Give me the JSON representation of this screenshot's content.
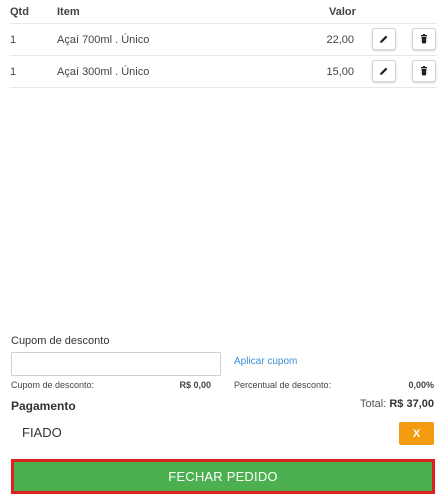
{
  "table": {
    "headers": {
      "qty": "Qtd",
      "item": "Item",
      "value": "Valor"
    },
    "rows": [
      {
        "qty": "1",
        "item": "Açaí 700ml . Único",
        "value": "22,00",
        "edit_icon": "pencil-icon",
        "delete_icon": "trash-icon"
      },
      {
        "qty": "1",
        "item": "Açaí 300ml . Único",
        "value": "15,00",
        "edit_icon": "pencil-icon",
        "delete_icon": "trash-icon"
      }
    ]
  },
  "coupon": {
    "title": "Cupom de desconto",
    "input_value": "",
    "input_placeholder": "",
    "apply_label": "Aplicar cupom"
  },
  "summary": {
    "coupon_label": "Cupom de desconto:",
    "coupon_value": "R$ 0,00",
    "percent_label": "Percentual de desconto:",
    "percent_value": "0,00%"
  },
  "payment": {
    "title": "Pagamento",
    "total_label": "Total:",
    "total_value": "R$ 37,00",
    "method": "FIADO",
    "remove_label": "X"
  },
  "actions": {
    "close_order_label": "FECHAR PEDIDO"
  },
  "colors": {
    "primary_green": "#4caf50",
    "highlight_border": "#dd2020",
    "warning_orange": "#f39c12",
    "link_blue": "#3a8fd8"
  }
}
